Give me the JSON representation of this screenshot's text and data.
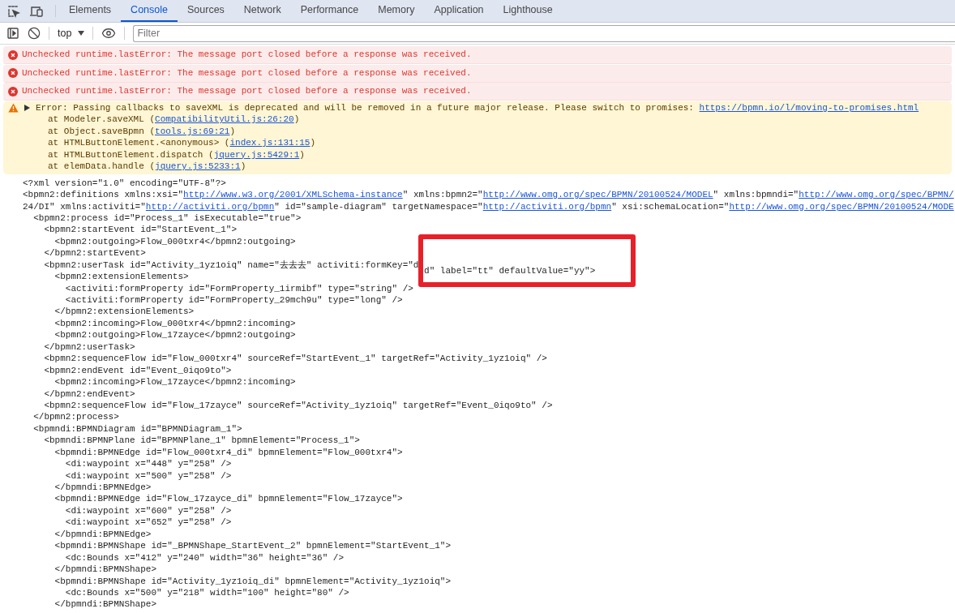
{
  "tabs": [
    {
      "label": "Elements",
      "selected": false
    },
    {
      "label": "Console",
      "selected": true
    },
    {
      "label": "Sources",
      "selected": false
    },
    {
      "label": "Network",
      "selected": false
    },
    {
      "label": "Performance",
      "selected": false
    },
    {
      "label": "Memory",
      "selected": false
    },
    {
      "label": "Application",
      "selected": false
    },
    {
      "label": "Lighthouse",
      "selected": false
    }
  ],
  "toolbar": {
    "context": "top",
    "filter": {
      "placeholder": "Filter"
    }
  },
  "messages": [
    {
      "kind": "error",
      "text": "Unchecked runtime.lastError: The message port closed before a response was received."
    },
    {
      "kind": "error",
      "text": "Unchecked runtime.lastError: The message port closed before a response was received."
    },
    {
      "kind": "error",
      "text": "Unchecked runtime.lastError: The message port closed before a response was received."
    },
    {
      "kind": "warning",
      "expanded": false,
      "text": "Error: Passing callbacks to saveXML is deprecated and will be removed in a future major release. Please switch to promises: ",
      "link": "https://bpmn.io/l/moving-to-promises.html",
      "stack": [
        {
          "prefix": "at Modeler.saveXML (",
          "link": "CompatibilityUtil.js:26:20",
          "suffix": ")"
        },
        {
          "prefix": "at Object.saveBpmn (",
          "link": "tools.js:69:21",
          "suffix": ")"
        },
        {
          "prefix": "at HTMLButtonElement.<anonymous> (",
          "link": "index.js:131:15",
          "suffix": ")"
        },
        {
          "prefix": "at HTMLButtonElement.dispatch (",
          "link": "jquery.js:5429:1",
          "suffix": ")"
        },
        {
          "prefix": "at elemData.handle (",
          "link": "jquery.js:5233:1",
          "suffix": ")"
        }
      ]
    }
  ],
  "xml": [
    {
      "line": "<?xml version=\"1.0\" encoding=\"UTF-8\"?>"
    },
    {
      "segments": [
        [
          {
            "kind": "text",
            "text": "<bpmn2:definitions xmlns:xsi=\""
          },
          {
            "kind": "link",
            "text": "http://www.w3.org/2001/XMLSchema-instance"
          },
          {
            "kind": "text",
            "text": "\" xmlns:bpmn2=\""
          },
          {
            "kind": "link",
            "text": "http://www.omg.org/spec/BPMN/20100524/MODEL"
          },
          {
            "kind": "text",
            "text": "\" xmlns:bpmndi=\""
          },
          {
            "kind": "link",
            "text": "http://www.omg.org/spec/BPMN/"
          }
        ],
        [
          {
            "kind": "text",
            "text": "24/DI\" xmlns:activiti=\""
          },
          {
            "kind": "link",
            "text": "http://activiti.org/bpmn"
          },
          {
            "kind": "text",
            "text": "\" id=\"sample-diagram\" targetNamespace=\""
          },
          {
            "kind": "link",
            "text": "http://activiti.org/bpmn"
          },
          {
            "kind": "text",
            "text": "\" xsi:schemaLocation=\""
          },
          {
            "kind": "link",
            "text": "http://www.omg.org/spec/BPMN/20100524/MODE"
          }
        ]
      ],
      "children": [
        {
          "line": "<bpmn2:process id=\"Process_1\" isExecutable=\"true\">",
          "children": [
            {
              "line": "<bpmn2:startEvent id=\"StartEvent_1\">",
              "children": [
                {
                  "line": "<bpmn2:outgoing>Flow_000txr4</bpmn2:outgoing>"
                }
              ],
              "close": "</bpmn2:startEvent>"
            },
            {
              "line": "<bpmn2:userTask id=\"Activity_1yz1oiq\" name=\"去去去\" activiti:formKey=\"d",
              "boxed": "d\" label=\"tt\" defaultValue=\"yy\">",
              "children": [
                {
                  "line": "<bpmn2:extensionElements>",
                  "children": [
                    {
                      "line": "<activiti:formProperty id=\"FormProperty_1irmibf\" type=\"string\" />"
                    },
                    {
                      "line": "<activiti:formProperty id=\"FormProperty_29mch9u\" type=\"long\" />"
                    }
                  ],
                  "close": "</bpmn2:extensionElements>"
                },
                {
                  "line": "<bpmn2:incoming>Flow_000txr4</bpmn2:incoming>"
                },
                {
                  "line": "<bpmn2:outgoing>Flow_17zayce</bpmn2:outgoing>"
                }
              ],
              "close": "</bpmn2:userTask>"
            },
            {
              "line": "<bpmn2:sequenceFlow id=\"Flow_000txr4\" sourceRef=\"StartEvent_1\" targetRef=\"Activity_1yz1oiq\" />"
            },
            {
              "line": "<bpmn2:endEvent id=\"Event_0iqo9to\">",
              "children": [
                {
                  "line": "<bpmn2:incoming>Flow_17zayce</bpmn2:incoming>"
                }
              ],
              "close": "</bpmn2:endEvent>"
            },
            {
              "line": "<bpmn2:sequenceFlow id=\"Flow_17zayce\" sourceRef=\"Activity_1yz1oiq\" targetRef=\"Event_0iqo9to\" />"
            }
          ],
          "close": "</bpmn2:process>"
        },
        {
          "line": "<bpmndi:BPMNDiagram id=\"BPMNDiagram_1\">",
          "children": [
            {
              "line": "<bpmndi:BPMNPlane id=\"BPMNPlane_1\" bpmnElement=\"Process_1\">",
              "children": [
                {
                  "line": "<bpmndi:BPMNEdge id=\"Flow_000txr4_di\" bpmnElement=\"Flow_000txr4\">",
                  "children": [
                    {
                      "line": "<di:waypoint x=\"448\" y=\"258\" />"
                    },
                    {
                      "line": "<di:waypoint x=\"500\" y=\"258\" />"
                    }
                  ],
                  "close": "</bpmndi:BPMNEdge>"
                },
                {
                  "line": "<bpmndi:BPMNEdge id=\"Flow_17zayce_di\" bpmnElement=\"Flow_17zayce\">",
                  "children": [
                    {
                      "line": "<di:waypoint x=\"600\" y=\"258\" />"
                    },
                    {
                      "line": "<di:waypoint x=\"652\" y=\"258\" />"
                    }
                  ],
                  "close": "</bpmndi:BPMNEdge>"
                },
                {
                  "line": "<bpmndi:BPMNShape id=\"_BPMNShape_StartEvent_2\" bpmnElement=\"StartEvent_1\">",
                  "children": [
                    {
                      "line": "<dc:Bounds x=\"412\" y=\"240\" width=\"36\" height=\"36\" />"
                    }
                  ],
                  "close": "</bpmndi:BPMNShape>"
                },
                {
                  "line": "<bpmndi:BPMNShape id=\"Activity_1yz1oiq_di\" bpmnElement=\"Activity_1yz1oiq\">",
                  "children": [
                    {
                      "line": "<dc:Bounds x=\"500\" y=\"218\" width=\"100\" height=\"80\" />"
                    }
                  ],
                  "close": "</bpmndi:BPMNShape>"
                }
              ]
            }
          ]
        }
      ]
    }
  ]
}
